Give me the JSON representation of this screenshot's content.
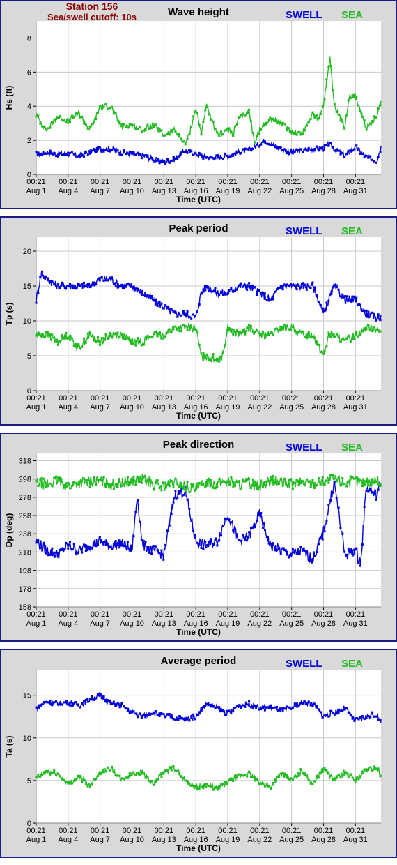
{
  "header": {
    "station": "Station 156",
    "cutoff": "Sea/swell cutoff: 10s"
  },
  "colors": {
    "swell": "#0000dd",
    "sea": "#22bb22",
    "panel_bg": "#d9d9d9",
    "frame": "#1a1a8c"
  },
  "legend": {
    "swell": "SWELL",
    "sea": "SEA"
  },
  "xaxis": {
    "label": "Time (UTC)",
    "ticks": [
      {
        "time": "00:21",
        "date": "Aug 1"
      },
      {
        "time": "00:21",
        "date": "Aug 4"
      },
      {
        "time": "00:21",
        "date": "Aug 7"
      },
      {
        "time": "00:21",
        "date": "Aug 10"
      },
      {
        "time": "00:21",
        "date": "Aug 13"
      },
      {
        "time": "00:21",
        "date": "Aug 16"
      },
      {
        "time": "00:21",
        "date": "Aug 19"
      },
      {
        "time": "00:21",
        "date": "Aug 22"
      },
      {
        "time": "00:21",
        "date": "Aug 25"
      },
      {
        "time": "00:21",
        "date": "Aug 28"
      },
      {
        "time": "00:21",
        "date": "Aug 31"
      }
    ]
  },
  "chart_data": [
    {
      "type": "line",
      "title": "Wave height",
      "xlabel": "Time (UTC)",
      "ylabel": "Hs (ft)",
      "ylim": [
        0,
        9
      ],
      "yticks": [
        0,
        2,
        4,
        6,
        8
      ],
      "x_day_range": [
        1,
        33.4
      ],
      "grid": true,
      "series": [
        {
          "name": "SWELL",
          "day": [
            1,
            1.5,
            2,
            3,
            4,
            5,
            6,
            7,
            8,
            9,
            10,
            11,
            12,
            13,
            14,
            15,
            16,
            17,
            18,
            19,
            20,
            21,
            22,
            22.5,
            23,
            24,
            25,
            26,
            27,
            28,
            28.5,
            29,
            30,
            31,
            32,
            33,
            33.4
          ],
          "values": [
            1.2,
            1.2,
            1.3,
            1.2,
            1.2,
            1.1,
            1.3,
            1.5,
            1.5,
            1.3,
            1.2,
            1.1,
            0.9,
            0.7,
            0.9,
            1.4,
            1.2,
            1.0,
            1.0,
            1.1,
            1.3,
            1.4,
            1.8,
            2.0,
            1.8,
            1.5,
            1.3,
            1.4,
            1.5,
            1.5,
            1.8,
            1.5,
            1.1,
            1.6,
            1.0,
            0.8,
            1.6
          ]
        },
        {
          "name": "SEA",
          "day": [
            1,
            1.5,
            2,
            3,
            4,
            5,
            6,
            6.5,
            7,
            8,
            9,
            10,
            11,
            12,
            13,
            14,
            15,
            15.3,
            16,
            16.5,
            17,
            18,
            19,
            19.5,
            20,
            21,
            21.5,
            22,
            23,
            24,
            25,
            26,
            27,
            27.5,
            28,
            28.3,
            28.6,
            29,
            30,
            30.4,
            31,
            32,
            33,
            33.4
          ],
          "values": [
            3.5,
            3.0,
            2.6,
            3.4,
            3.1,
            3.6,
            2.6,
            3.2,
            4.0,
            4.0,
            2.8,
            2.9,
            2.6,
            2.9,
            2.3,
            2.6,
            1.8,
            2.2,
            3.9,
            2.4,
            4.0,
            2.3,
            2.6,
            2.4,
            3.2,
            3.7,
            1.9,
            2.6,
            3.3,
            3.0,
            2.5,
            2.4,
            3.6,
            3.2,
            4.1,
            5.5,
            6.8,
            4.0,
            2.8,
            4.6,
            4.6,
            2.7,
            3.4,
            4.3
          ]
        }
      ]
    },
    {
      "type": "line",
      "title": "Peak period",
      "xlabel": "Time (UTC)",
      "ylabel": "Tp (s)",
      "ylim": [
        0,
        22
      ],
      "yticks": [
        0,
        5,
        10,
        15,
        20
      ],
      "x_day_range": [
        1,
        33.4
      ],
      "grid": true,
      "series": [
        {
          "name": "SWELL",
          "day": [
            1,
            1.5,
            2,
            3,
            4,
            5,
            6,
            7,
            8,
            9,
            10,
            11,
            12,
            13,
            14,
            15,
            16,
            16.5,
            17,
            18,
            19,
            20,
            21,
            22,
            23,
            24,
            25,
            26,
            27,
            28,
            29,
            30,
            31,
            32,
            33,
            33.4
          ],
          "values": [
            13,
            17,
            16,
            15,
            15,
            15,
            15,
            16,
            16,
            15,
            15,
            14,
            13,
            12,
            11,
            11,
            10.5,
            14,
            15,
            14,
            14,
            15,
            15,
            14,
            13,
            15,
            15,
            15,
            15,
            11,
            15,
            13,
            13,
            11,
            10.5,
            10.5
          ]
        },
        {
          "name": "SEA",
          "day": [
            1,
            2,
            3,
            4,
            5,
            6,
            7,
            8,
            9,
            10,
            11,
            12,
            13,
            14,
            15,
            16,
            16.5,
            17,
            18,
            18.5,
            19,
            20,
            21,
            22,
            23,
            24,
            25,
            26,
            27,
            28,
            28.5,
            29,
            30,
            31,
            32,
            33,
            33.4
          ],
          "values": [
            8,
            8,
            7,
            8,
            6,
            8,
            7,
            8,
            8,
            7,
            7,
            8,
            8,
            9,
            9,
            9,
            5,
            5,
            4.5,
            5,
            9,
            8,
            9,
            8,
            8,
            9,
            9,
            8,
            8,
            5,
            8,
            8,
            7,
            8,
            9,
            9,
            8
          ]
        }
      ]
    },
    {
      "type": "line",
      "title": "Peak direction",
      "xlabel": "Time (UTC)",
      "ylabel": "Dp (deg)",
      "ylim": [
        158,
        326
      ],
      "yticks": [
        158,
        178,
        198,
        218,
        238,
        258,
        278,
        298,
        318
      ],
      "x_day_range": [
        1,
        33.4
      ],
      "grid": true,
      "series": [
        {
          "name": "SWELL",
          "day": [
            1,
            2,
            3,
            4,
            5,
            6,
            7,
            8,
            9,
            10,
            10.5,
            11,
            12,
            13,
            14,
            15,
            16,
            17,
            18,
            19,
            20,
            21,
            22,
            23,
            24,
            25,
            26,
            27,
            28,
            29,
            30,
            31,
            31.5,
            32,
            33,
            33.4
          ],
          "values": [
            230,
            220,
            215,
            225,
            220,
            225,
            230,
            225,
            228,
            220,
            280,
            225,
            220,
            215,
            280,
            285,
            230,
            225,
            230,
            260,
            230,
            235,
            260,
            225,
            220,
            215,
            220,
            210,
            240,
            295,
            215,
            220,
            205,
            290,
            280,
            295
          ]
        },
        {
          "name": "SEA",
          "day": [
            1,
            2,
            3,
            4,
            5,
            6,
            7,
            8,
            9,
            10,
            11,
            12,
            13,
            14,
            15,
            16,
            17,
            18,
            19,
            20,
            21,
            22,
            23,
            24,
            25,
            26,
            27,
            28,
            29,
            30,
            31,
            32,
            33,
            33.4
          ],
          "values": [
            294,
            292,
            296,
            290,
            294,
            295,
            296,
            292,
            294,
            296,
            298,
            292,
            290,
            294,
            290,
            286,
            295,
            293,
            296,
            292,
            294,
            290,
            296,
            294,
            292,
            295,
            293,
            296,
            298,
            294,
            296,
            294,
            298,
            292
          ]
        }
      ]
    },
    {
      "type": "line",
      "title": "Average period",
      "xlabel": "Time (UTC)",
      "ylabel": "Ta (s)",
      "ylim": [
        0,
        18
      ],
      "yticks": [
        0,
        5,
        10,
        15
      ],
      "x_day_range": [
        1,
        33.4
      ],
      "grid": true,
      "series": [
        {
          "name": "SWELL",
          "day": [
            1,
            2,
            3,
            4,
            5,
            6,
            7,
            8,
            9,
            10,
            11,
            12,
            13,
            14,
            15,
            16,
            17,
            18,
            19,
            20,
            21,
            22,
            23,
            24,
            25,
            26,
            27,
            28,
            29,
            30,
            31,
            32,
            33,
            33.4
          ],
          "values": [
            13.5,
            14.2,
            14,
            14.2,
            13.8,
            14.5,
            15,
            14,
            13.8,
            13,
            12.5,
            13,
            12.6,
            12.4,
            12.2,
            12.5,
            14,
            13.5,
            12.8,
            13.8,
            14,
            13.5,
            13.6,
            13.2,
            13.5,
            14.2,
            14,
            12.5,
            13,
            13.5,
            12,
            12.5,
            12.8,
            11.6
          ]
        },
        {
          "name": "SEA",
          "day": [
            1,
            2,
            3,
            4,
            5,
            6,
            7,
            8,
            9,
            10,
            11,
            12,
            13,
            14,
            15,
            16,
            17,
            18,
            19,
            20,
            21,
            22,
            23,
            24,
            25,
            26,
            27,
            28,
            29,
            30,
            31,
            32,
            33,
            33.4
          ],
          "values": [
            5.2,
            6,
            5.8,
            4.6,
            5.4,
            4.4,
            6,
            6.5,
            5,
            5.8,
            6,
            4.5,
            6,
            6.5,
            5,
            4.2,
            4.5,
            4,
            4.8,
            5.5,
            5.8,
            4.8,
            4.2,
            5.8,
            5,
            6.2,
            4.6,
            6.5,
            5,
            6,
            5,
            6.2,
            6.5,
            5.6
          ]
        }
      ]
    }
  ]
}
